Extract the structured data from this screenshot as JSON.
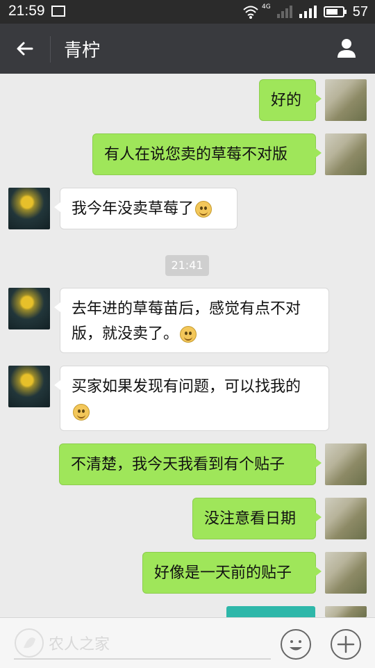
{
  "status_bar": {
    "time": "21:59",
    "network": "4G",
    "battery": "57"
  },
  "header": {
    "title": "青柠"
  },
  "messages": [
    {
      "text": "好的",
      "emoji": false
    },
    {
      "text": "有人在说您卖的草莓不对版",
      "emoji": false
    },
    {
      "text": "我今年没卖草莓了",
      "emoji": true
    },
    {
      "time": "21:41"
    },
    {
      "line1": "去年进的草莓苗后，感觉有点不对",
      "line2": "版，就没卖了。",
      "emoji": true
    },
    {
      "line1": "买家如果发现有问题，可以找我的",
      "emoji": true
    },
    {
      "text": "不清楚，我今天我看到有个贴子",
      "emoji": false
    },
    {
      "text": "没注意看日期",
      "emoji": false
    },
    {
      "text": "好像是一天前的贴子",
      "emoji": false
    }
  ],
  "watermark": "农人之家",
  "icons": {
    "back": "back-arrow-icon",
    "profile": "person-icon",
    "emoji": "smile-icon",
    "more": "plus-icon"
  },
  "colors": {
    "topbar": "#393a3e",
    "mine_bubble": "#9fe65a",
    "their_bubble": "#ffffff",
    "background": "#ebebeb"
  }
}
